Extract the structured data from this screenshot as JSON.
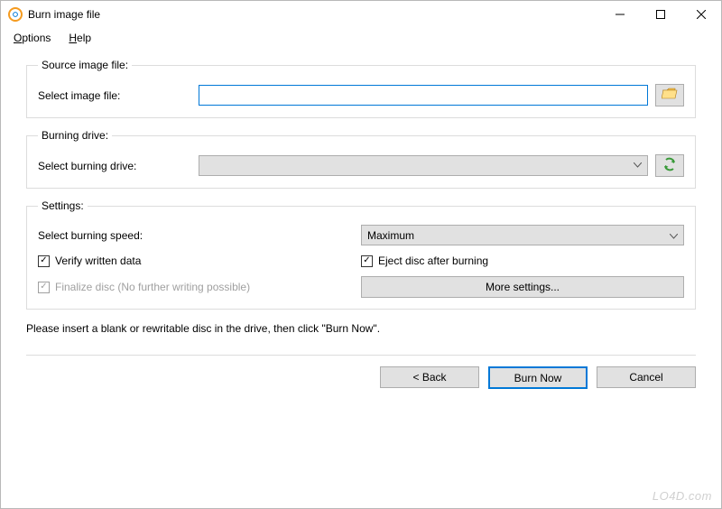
{
  "window": {
    "title": "Burn image file",
    "min": "—",
    "max": "▢",
    "close": "✕"
  },
  "menu": {
    "options_u": "O",
    "options_rest": "ptions",
    "help_u": "H",
    "help_rest": "elp"
  },
  "source": {
    "legend": "Source image file:",
    "label": "Select image file:",
    "value": ""
  },
  "drive": {
    "legend": "Burning drive:",
    "label": "Select burning drive:",
    "value": ""
  },
  "settings": {
    "legend": "Settings:",
    "speed_label": "Select burning speed:",
    "speed_value": "Maximum",
    "verify_label": "Verify written data",
    "eject_label": "Eject disc after burning",
    "finalize_label": "Finalize disc (No further writing possible)",
    "more_label": "More settings..."
  },
  "instruction": "Please insert a blank or rewritable disc in the drive, then click \"Burn Now\".",
  "footer": {
    "back": "< Back",
    "burn": "Burn Now",
    "cancel": "Cancel"
  },
  "watermark": "LO4D.com",
  "checkmark": "✓"
}
